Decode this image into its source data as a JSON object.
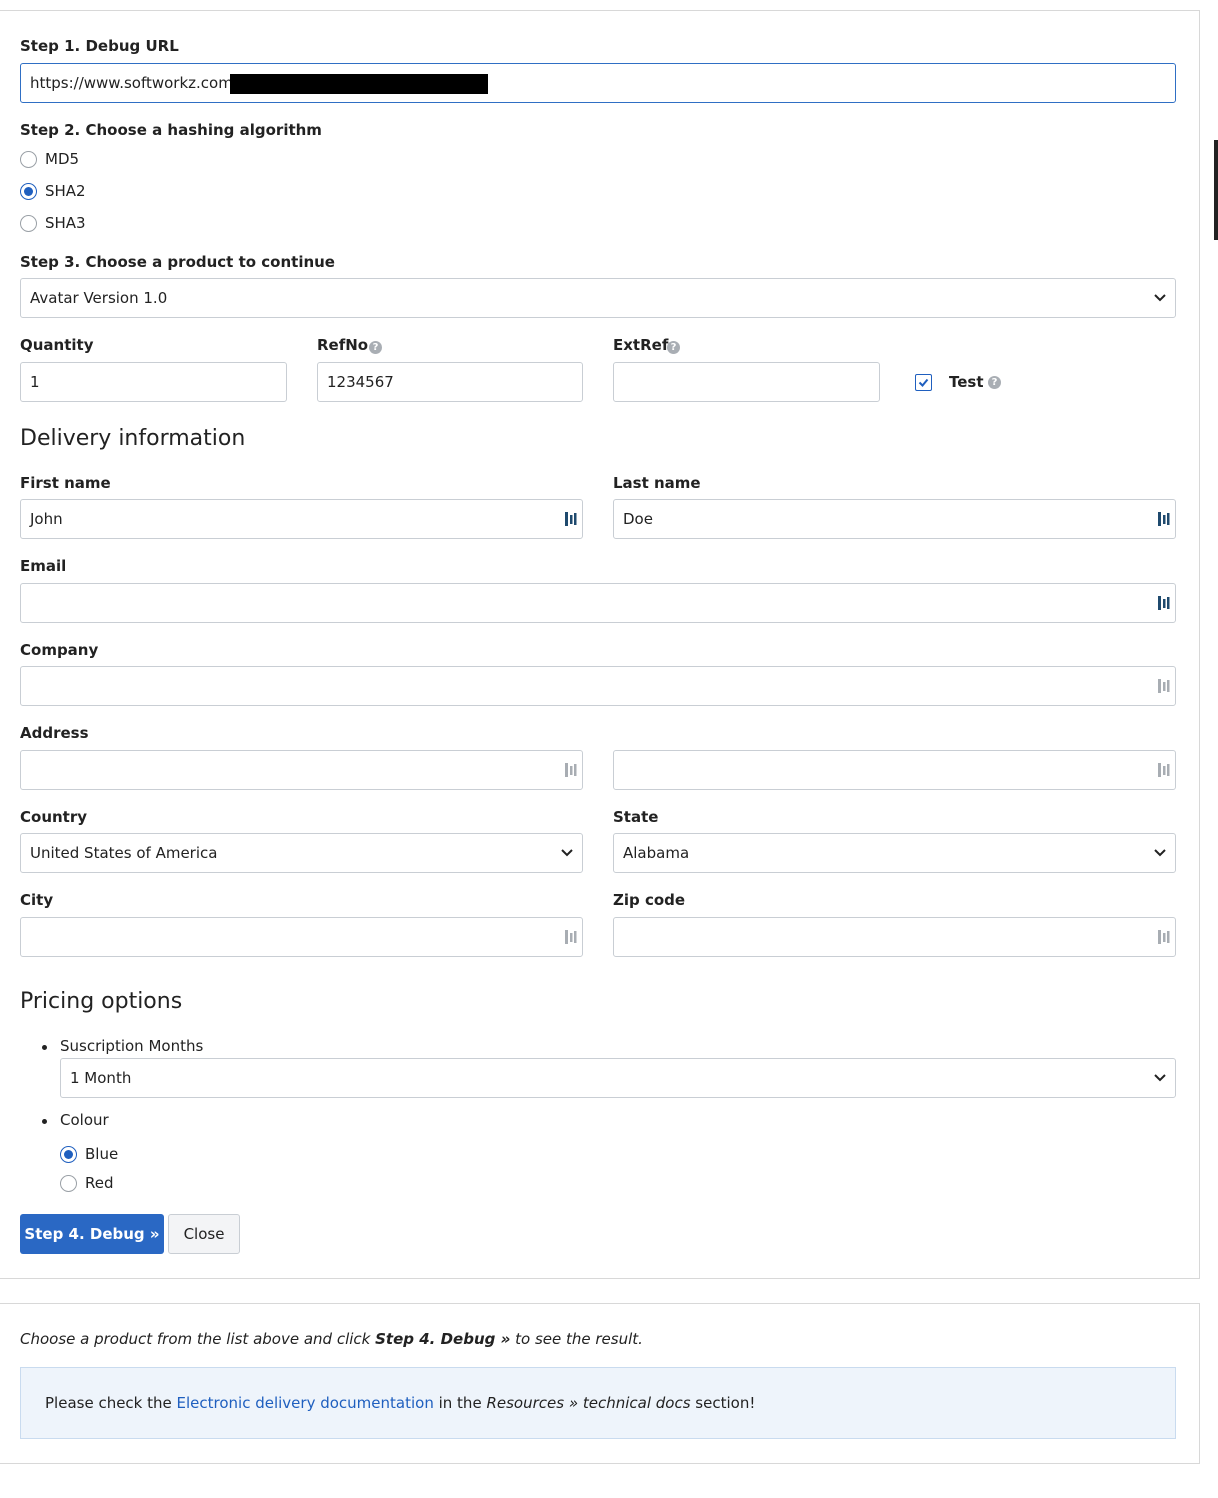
{
  "step1": {
    "label": "Step 1. Debug URL",
    "url_value": "https://www.softworkz.com"
  },
  "step2": {
    "label": "Step 2. Choose a hashing algorithm",
    "options": [
      {
        "label": "MD5",
        "selected": false
      },
      {
        "label": "SHA2",
        "selected": true
      },
      {
        "label": "SHA3",
        "selected": false
      }
    ]
  },
  "step3": {
    "label": "Step 3. Choose a product to continue",
    "product_value": "Avatar Version 1.0"
  },
  "order": {
    "quantity_label": "Quantity",
    "quantity_value": "1",
    "refno_label": "RefNo",
    "refno_value": "1234567",
    "extref_label": "ExtRef",
    "extref_value": "",
    "test_label": "Test",
    "test_checked": true
  },
  "delivery": {
    "heading": "Delivery information",
    "first_name_label": "First name",
    "first_name_value": "John",
    "last_name_label": "Last name",
    "last_name_value": "Doe",
    "email_label": "Email",
    "email_value": "",
    "company_label": "Company",
    "company_value": "",
    "address_label": "Address",
    "address1_value": "",
    "address2_value": "",
    "country_label": "Country",
    "country_value": "United States of America",
    "state_label": "State",
    "state_value": "Alabama",
    "city_label": "City",
    "city_value": "",
    "zip_label": "Zip code",
    "zip_value": ""
  },
  "pricing": {
    "heading": "Pricing options",
    "subscription_label": "Suscription Months",
    "subscription_value": "1 Month",
    "colour_label": "Colour",
    "colour_options": [
      {
        "label": "Blue",
        "selected": true
      },
      {
        "label": "Red",
        "selected": false
      }
    ]
  },
  "actions": {
    "debug_label": "Step 4. Debug »",
    "close_label": "Close"
  },
  "result": {
    "hint_before": "Choose a product from the list above and click ",
    "hint_bold": "Step 4. Debug »",
    "hint_after": " to see the result.",
    "info_before": "Please check the ",
    "info_link": "Electronic delivery documentation",
    "info_middle": " in the ",
    "info_italic": "Resources » technical docs",
    "info_after": " section!"
  },
  "colors": {
    "primary": "#2a68c4",
    "link": "#1f5fbf",
    "info_bg": "#eef4fb"
  },
  "icons": [
    "chevron-down-icon",
    "help-icon",
    "password-manager-icon",
    "checkmark-icon"
  ]
}
